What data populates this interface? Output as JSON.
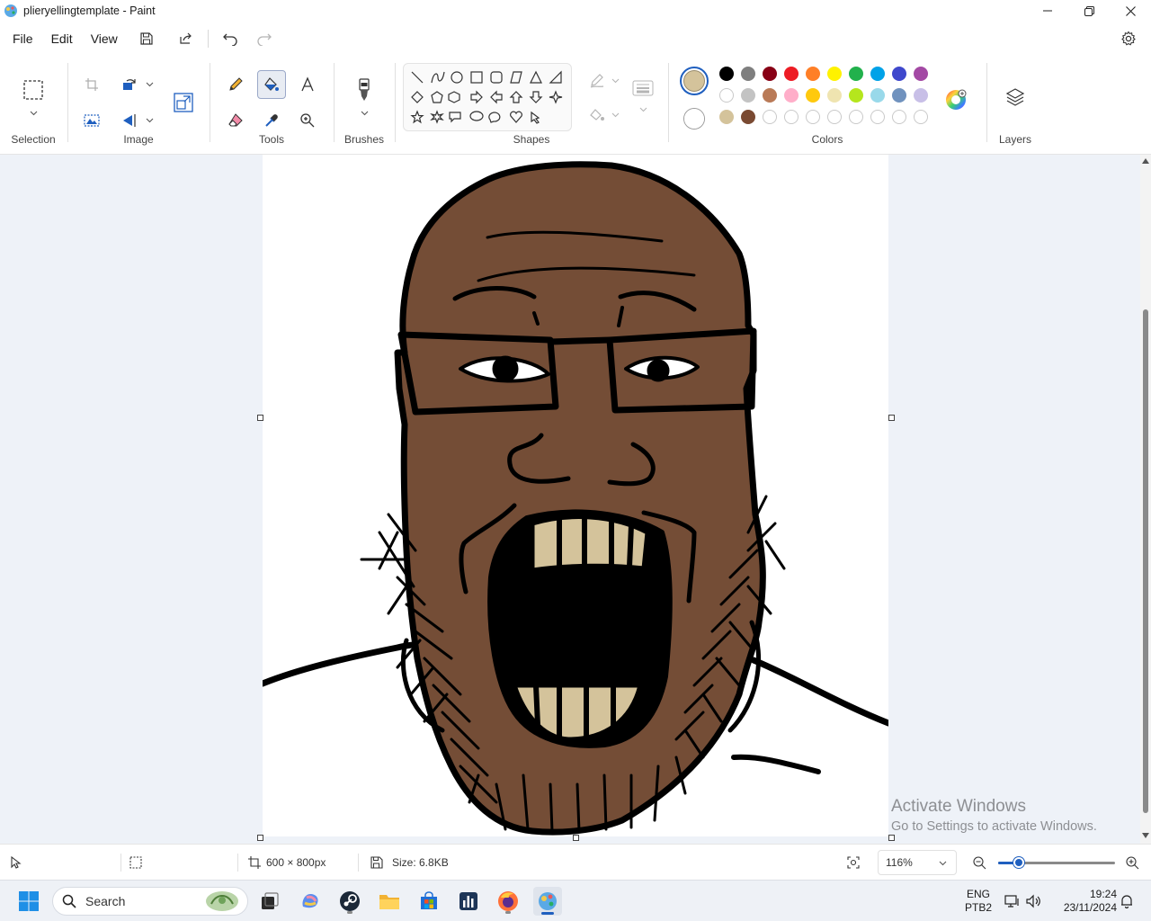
{
  "window": {
    "title": "plieryellingtemplate - Paint"
  },
  "menu": {
    "file": "File",
    "edit": "Edit",
    "view": "View"
  },
  "ribbon": {
    "groups": {
      "selection": "Selection",
      "image": "Image",
      "tools": "Tools",
      "brushes": "Brushes",
      "shapes": "Shapes",
      "colors": "Colors",
      "layers": "Layers"
    },
    "active_tool": "fill-icon",
    "primary_color": "#d4c39b",
    "secondary_color": "#ffffff",
    "palette_row1": [
      "#000000",
      "#7f7f7f",
      "#880015",
      "#ed1c24",
      "#ff7f27",
      "#fff200",
      "#22b14c",
      "#00a2e8",
      "#3f48cc",
      "#a349a4"
    ],
    "palette_row2": [
      "#ffffff",
      "#c3c3c3",
      "#b97a57",
      "#ffaec9",
      "#ffc90e",
      "#efe4b0",
      "#b5e61d",
      "#99d9ea",
      "#7092be",
      "#c8bfe7"
    ],
    "palette_row3": [
      "#d4c39b",
      "#7a4a32",
      "",
      "",
      "",
      "",
      "",
      "",
      "",
      ""
    ]
  },
  "watermark": {
    "line1": "Activate Windows",
    "line2": "Go to Settings to activate Windows."
  },
  "statusbar": {
    "canvas_size": "600 × 800px",
    "file_size": "Size: 6.8KB",
    "zoom": "116%"
  },
  "taskbar": {
    "search_placeholder": "Search",
    "language": "ENG",
    "layout": "PTB2",
    "time": "19:24",
    "date": "23/11/2024"
  }
}
